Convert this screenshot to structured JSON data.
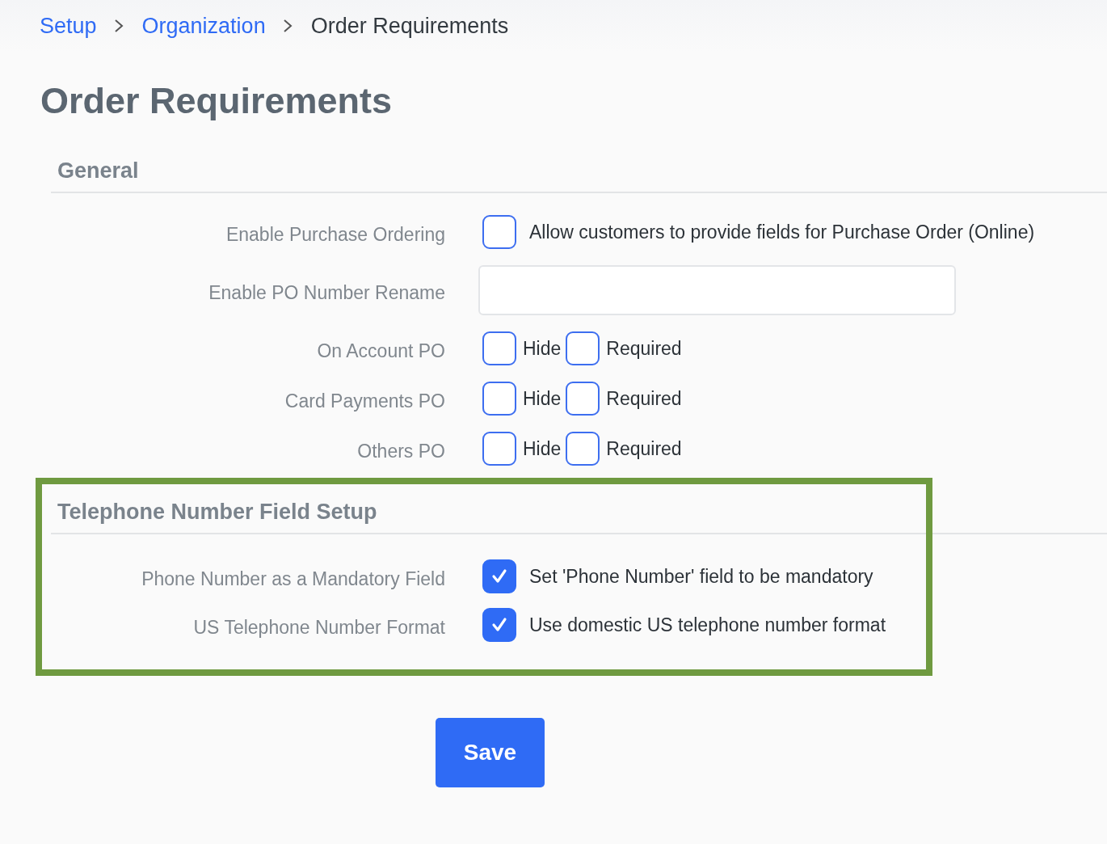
{
  "breadcrumb": [
    {
      "label": "Setup",
      "kind": "link"
    },
    {
      "label": "Organization",
      "kind": "link"
    },
    {
      "label": "Order Requirements",
      "kind": "current"
    }
  ],
  "title": "Order Requirements",
  "sections": [
    {
      "title": "General",
      "highlighted": false,
      "rows": [
        {
          "label": "Enable Purchase Ordering",
          "kind": "checkbox",
          "checked": false,
          "text": "Allow customers to provide fields for Purchase Order (Online)"
        },
        {
          "label": "Enable PO Number Rename",
          "kind": "text_field"
        },
        {
          "label": "On Account PO",
          "kind": "options",
          "options": [
            {
              "label": "Hide",
              "checked": false
            },
            {
              "label": "Required",
              "checked": false
            }
          ]
        },
        {
          "label": "Card Payments PO",
          "kind": "options",
          "options": [
            {
              "label": "Hide",
              "checked": false
            },
            {
              "label": "Required",
              "checked": false
            }
          ]
        },
        {
          "label": "Others PO",
          "kind": "options",
          "options": [
            {
              "label": "Hide",
              "checked": false
            },
            {
              "label": "Required",
              "checked": false
            }
          ]
        }
      ]
    },
    {
      "title": "Telephone Number Field Setup",
      "highlighted": true,
      "rows": [
        {
          "label": "Phone Number as a Mandatory Field",
          "kind": "checkbox",
          "checked": true,
          "text": "Set 'Phone Number' field to be mandatory"
        },
        {
          "label": "US Telephone Number Format",
          "kind": "checkbox",
          "checked": true,
          "text": "Use domestic US telephone number format"
        }
      ]
    }
  ],
  "save_button": "Save"
}
